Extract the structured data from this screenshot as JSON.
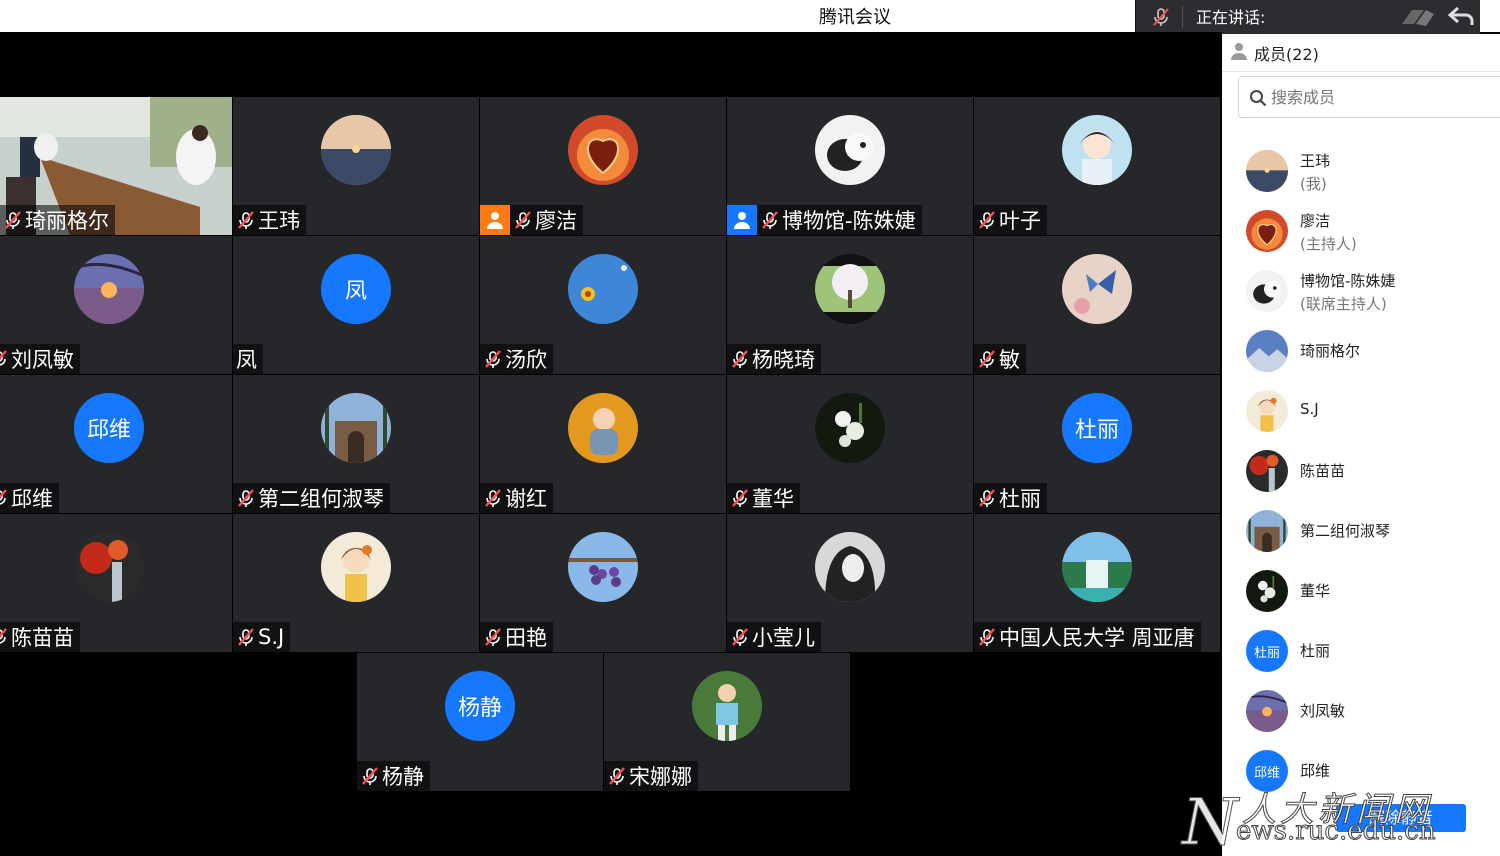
{
  "app": {
    "title": "腾讯会议"
  },
  "speaking": {
    "label": "正在讲话:"
  },
  "colors": {
    "accent": "#1677ff",
    "host_badge": "#ff7a12",
    "cohost_badge": "#1677ff",
    "tile_bg": "#25272b"
  },
  "tiles": [
    {
      "name": "琦丽格尔",
      "video": true
    },
    {
      "name": "王玮",
      "avatar": "sunset-sea"
    },
    {
      "name": "廖洁",
      "avatar": "heart-leaf",
      "badge": "host"
    },
    {
      "name": "博物馆-陈姝婕",
      "avatar": "panda-dog",
      "badge": "cohost"
    },
    {
      "name": "叶子",
      "avatar": "anime-girl"
    },
    {
      "name": "刘凤敏",
      "avatar": "sunset-tree"
    },
    {
      "name": "凤",
      "avatar_text": "凤",
      "no_mute": true
    },
    {
      "name": "汤欣",
      "avatar": "blue-sky-flower"
    },
    {
      "name": "杨晓琦",
      "avatar": "blossom-tree"
    },
    {
      "name": "敏",
      "avatar": "butterfly"
    },
    {
      "name": "邱维",
      "avatar_text": "邱维"
    },
    {
      "name": "第二组何淑琴",
      "avatar": "archway"
    },
    {
      "name": "谢红",
      "avatar": "baby"
    },
    {
      "name": "董华",
      "avatar": "white-flowers"
    },
    {
      "name": "杜丽",
      "avatar_text": "杜丽"
    },
    {
      "name": "陈苗苗",
      "avatar": "red-leaves"
    },
    {
      "name": "S.J",
      "avatar": "illustrated-girl"
    },
    {
      "name": "田艳",
      "avatar": "grapes"
    },
    {
      "name": "小莹儿",
      "avatar": "portrait-bw"
    },
    {
      "name": "中国人民大学  周亚唐",
      "avatar": "waterfall"
    },
    {
      "name": "杨静",
      "avatar_text": "杨静"
    },
    {
      "name": "宋娜娜",
      "avatar": "child-outdoor"
    }
  ],
  "panel": {
    "members_label": "成员(22)",
    "search_placeholder": "搜索成员",
    "members": [
      {
        "name": "王玮",
        "role": "(我)",
        "avatar": "sunset-sea"
      },
      {
        "name": "廖洁",
        "role": "(主持人)",
        "avatar": "heart-leaf"
      },
      {
        "name": "博物馆-陈姝婕",
        "role": "(联席主持人)",
        "avatar": "panda-dog"
      },
      {
        "name": "琦丽格尔",
        "avatar": "mountain-sky"
      },
      {
        "name": "S.J",
        "avatar": "illustrated-girl"
      },
      {
        "name": "陈苗苗",
        "avatar": "red-leaves"
      },
      {
        "name": "第二组何淑琴",
        "avatar": "archway"
      },
      {
        "name": "董华",
        "avatar": "white-flowers"
      },
      {
        "name": "杜丽",
        "avatar_text": "杜丽"
      },
      {
        "name": "刘凤敏",
        "avatar": "sunset-tree"
      },
      {
        "name": "邱维",
        "avatar_text": "邱维"
      }
    ],
    "unmute_label": "解除静音"
  },
  "watermark": {
    "line1": "人大新闻网",
    "line2": "ews.ruc.edu.cn",
    "initial": "N"
  }
}
